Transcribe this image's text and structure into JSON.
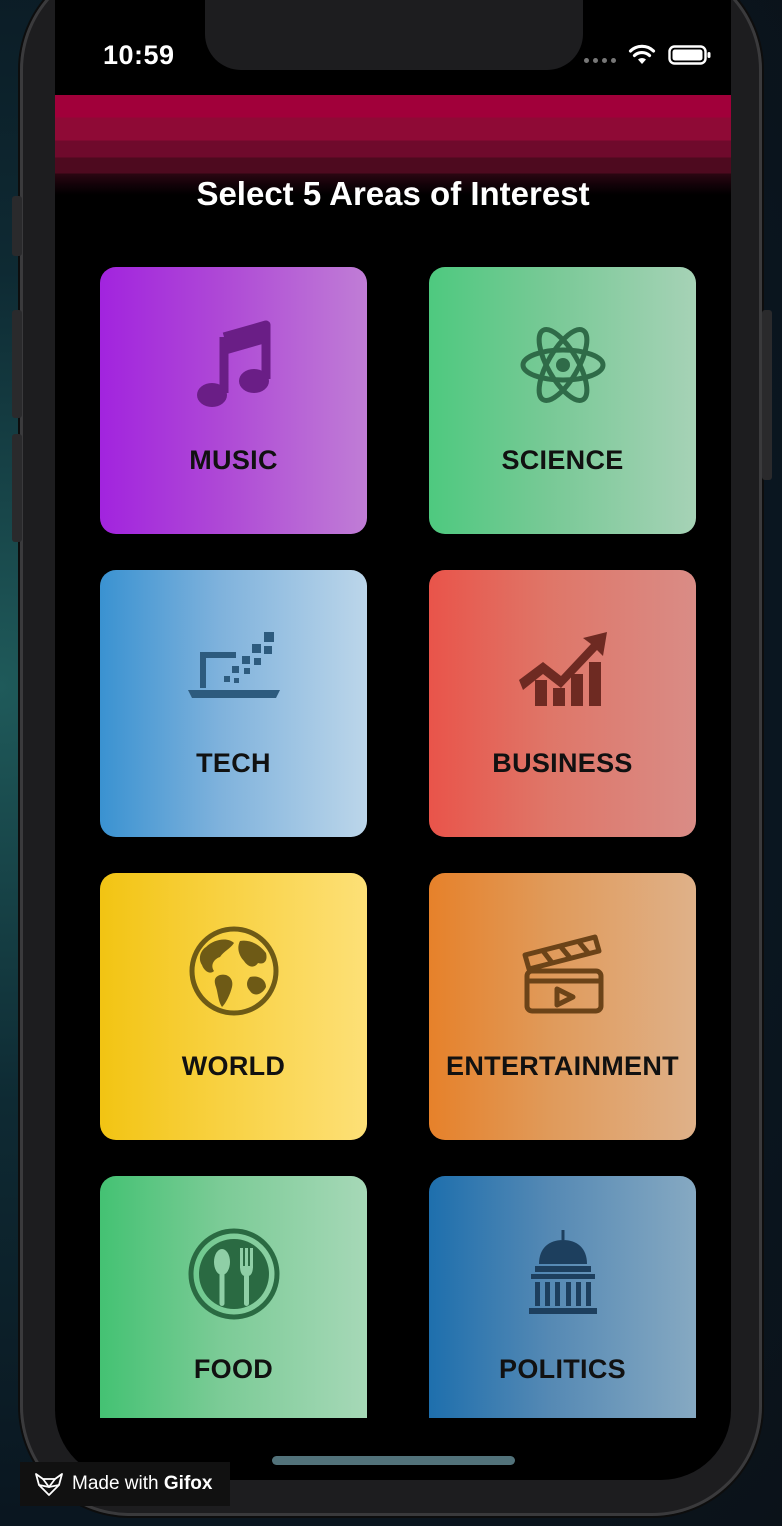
{
  "status_bar": {
    "time": "10:59"
  },
  "header": {
    "title": "Select 5 Areas of Interest"
  },
  "categories": [
    {
      "label": "MUSIC",
      "icon": "music-note-icon",
      "color": "#a224de"
    },
    {
      "label": "SCIENCE",
      "icon": "atom-icon",
      "color": "#4ec97f"
    },
    {
      "label": "TECH",
      "icon": "laptop-pixels-icon",
      "color": "#3a92d1"
    },
    {
      "label": "BUSINESS",
      "icon": "growth-chart-icon",
      "color": "#e9544a"
    },
    {
      "label": "WORLD",
      "icon": "globe-icon",
      "color": "#f2c413"
    },
    {
      "label": "ENTERTAINMENT",
      "icon": "clapperboard-icon",
      "color": "#e6812a"
    },
    {
      "label": "FOOD",
      "icon": "fork-spoon-icon",
      "color": "#44c273"
    },
    {
      "label": "POLITICS",
      "icon": "capitol-building-icon",
      "color": "#1e6fad"
    }
  ],
  "watermark": {
    "prefix": "Made with",
    "brand": "Gifox"
  }
}
